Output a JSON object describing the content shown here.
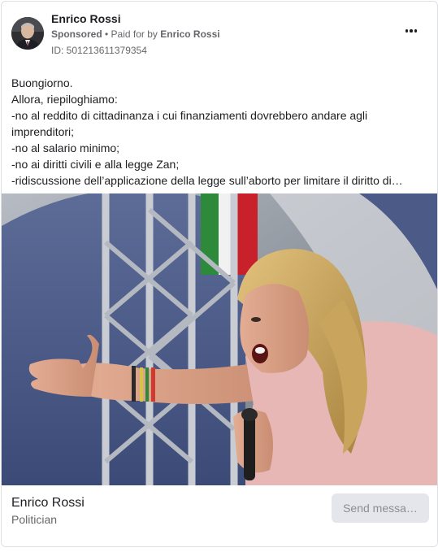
{
  "ad": {
    "advertiser_name": "Enrico Rossi",
    "sponsored_label": "Sponsored",
    "separator": " • ",
    "paid_for_prefix": "Paid for by ",
    "paid_for_by": "Enrico Rossi",
    "ad_id_text": "ID: 501213611379354",
    "more_icon": "more-horizontal-icon"
  },
  "body": {
    "lines": [
      "Buongiorno.",
      "Allora, riepiloghiamo:",
      "-no al reddito di cittadinanza i cui finanziamenti dovrebbero andare agli imprenditori;",
      "-no al salario minimo;",
      "-no ai diritti civili e alla legge Zan;",
      "-ridiscussione dell’applicazione della legge sull’aborto per limitare il diritto di…"
    ]
  },
  "footer": {
    "page_name": "Enrico Rossi",
    "page_category": "Politician",
    "cta_label": "Send messa…"
  },
  "colors": {
    "text_primary": "#1c1e21",
    "text_secondary": "#65676b",
    "button_bg": "#e4e6eb",
    "button_text": "#8a8d91"
  }
}
